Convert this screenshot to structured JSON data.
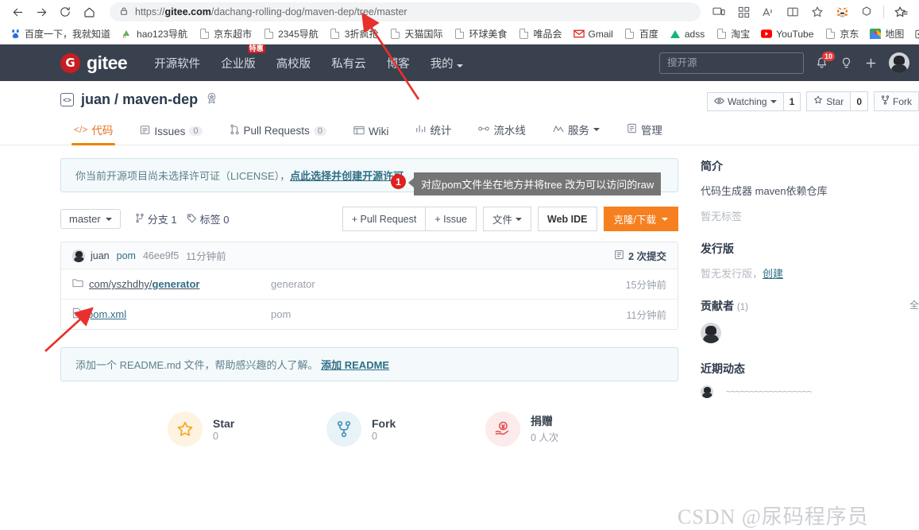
{
  "browser": {
    "url_prefix": "https://",
    "url_bold": "gitee.com",
    "url_suffix": "/dachang-rolling-dog/maven-dep/tree/master",
    "back_icon": "back-arrow-icon",
    "forward_icon": "forward-arrow-icon",
    "reload_icon": "reload-icon",
    "home_icon": "home-icon",
    "lock_icon": "lock-icon",
    "toolbar_icons": [
      {
        "name": "split-screen-icon",
        "glyph": "❐"
      },
      {
        "name": "collections-icon",
        "glyph": "▒"
      },
      {
        "name": "read-aloud-icon",
        "glyph": "A"
      },
      {
        "name": "reading-view-icon",
        "glyph": "◫"
      },
      {
        "name": "favorite-star-icon",
        "glyph": "☆"
      },
      {
        "name": "metamask-extension-icon",
        "glyph": "🦊"
      },
      {
        "name": "extension-puzzle-icon",
        "glyph": "⬡"
      },
      {
        "name": "favorites-list-icon",
        "glyph": "☆"
      }
    ],
    "bookmarks": [
      {
        "label": "百度一下，我就知道",
        "icon": "baidu-icon"
      },
      {
        "label": "hao123导航",
        "icon": "hao123-icon"
      },
      {
        "label": "京东超市",
        "icon": "page-icon"
      },
      {
        "label": "2345导航",
        "icon": "page-icon"
      },
      {
        "label": "3折疯抢",
        "icon": "page-icon"
      },
      {
        "label": "天猫国际",
        "icon": "page-icon"
      },
      {
        "label": "环球美食",
        "icon": "page-icon"
      },
      {
        "label": "唯品会",
        "icon": "page-icon"
      },
      {
        "label": "Gmail",
        "icon": "gmail-icon"
      },
      {
        "label": "百度",
        "icon": "page-icon"
      },
      {
        "label": "adss",
        "icon": "vercel-icon"
      },
      {
        "label": "淘宝",
        "icon": "page-icon"
      },
      {
        "label": "YouTube",
        "icon": "youtube-icon"
      },
      {
        "label": "京东",
        "icon": "page-icon"
      },
      {
        "label": "地图",
        "icon": "maps-icon"
      },
      {
        "label": "",
        "icon": "other-bookmarks-icon"
      }
    ]
  },
  "gitee_header": {
    "logo_mark": "G",
    "logo_word": "gitee",
    "nav": [
      {
        "label": "开源软件",
        "badge": ""
      },
      {
        "label": "企业版",
        "badge": "特惠"
      },
      {
        "label": "高校版",
        "badge": ""
      },
      {
        "label": "私有云",
        "badge": ""
      },
      {
        "label": "博客",
        "badge": ""
      },
      {
        "label": "我的",
        "badge": "",
        "caret": true
      }
    ],
    "search_placeholder": "搜开源",
    "notification_count": "10",
    "bell_icon": "bell-icon",
    "idea_icon": "lightbulb-icon",
    "plus_icon": "plus-icon",
    "avatar": "user-avatar"
  },
  "repo": {
    "owner": "juan",
    "separator": "/",
    "name": "maven-dep",
    "repo_icon": "code-repo-icon",
    "badge_icon": "award-badge-icon",
    "watch_label": "Watching",
    "watch_count": "1",
    "star_label": "Star",
    "star_count": "0",
    "fork_label": "Fork",
    "eye_icon": "eye-icon",
    "star_icon": "star-icon",
    "fork_icon": "fork-icon",
    "tabs": [
      {
        "label": "代码",
        "icon": "code-icon",
        "count": "",
        "active": true
      },
      {
        "label": "Issues",
        "icon": "issue-icon",
        "count": "0",
        "active": false
      },
      {
        "label": "Pull Requests",
        "icon": "pr-icon",
        "count": "0",
        "active": false
      },
      {
        "label": "Wiki",
        "icon": "wiki-icon",
        "count": "",
        "active": false
      },
      {
        "label": "统计",
        "icon": "chart-icon",
        "count": "",
        "active": false
      },
      {
        "label": "流水线",
        "icon": "pipeline-icon",
        "count": "",
        "active": false
      },
      {
        "label": "服务",
        "icon": "service-icon",
        "count": "",
        "active": false,
        "caret": true
      },
      {
        "label": "管理",
        "icon": "manage-icon",
        "count": "",
        "active": false
      }
    ]
  },
  "license_notice": {
    "text": "你当前开源项目尚未选择许可证（LICENSE），",
    "link": "点此选择并创建开源许可"
  },
  "file_toolbar": {
    "branch": "master",
    "branch_count_label": "分支 1",
    "tag_count_label": "标签 0",
    "branch_icon": "branch-icon",
    "tag_icon": "tag-icon",
    "pull_request_button": "+ Pull Request",
    "issue_button": "+ Issue",
    "files_button": "文件",
    "web_ide_button": "Web IDE",
    "clone_button": "克隆/下载"
  },
  "commit_bar": {
    "avatar": "user-avatar",
    "author": "juan",
    "message": "pom",
    "sha": "46ee9f5",
    "time": "11分钟前",
    "commits_icon": "commits-icon",
    "commits_label": "2 次提交"
  },
  "files": [
    {
      "icon": "folder-icon",
      "name_prefix": "com/yszhdhy/",
      "name_bold": "generator",
      "commit": "generator",
      "time": "15分钟前",
      "is_folder": true
    },
    {
      "icon": "file-icon",
      "name_prefix": "",
      "name_bold": "pom.xml",
      "commit": "pom",
      "time": "11分钟前",
      "is_folder": false
    }
  ],
  "readme_notice": {
    "text": "添加一个 README.md 文件，帮助感兴趣的人了解。",
    "link": "添加 README"
  },
  "stats": [
    {
      "label": "Star",
      "value": "0",
      "icon": "star-icon",
      "circle_bg": "#fdf3e0",
      "icon_color": "#f5a623"
    },
    {
      "label": "Fork",
      "value": "0",
      "icon": "fork-icon",
      "circle_bg": "#e8f3f7",
      "icon_color": "#4a90b8"
    },
    {
      "label": "捐赠",
      "value": "0 人次",
      "icon": "donate-icon",
      "circle_bg": "#fdeaea",
      "icon_color": "#e0585b"
    }
  ],
  "sidebar": {
    "intro_title": "简介",
    "intro_text": "代码生成器 maven依赖仓库",
    "no_tags": "暂无标签",
    "release_title": "发行版",
    "no_release": "暂无发行版，",
    "create_link": "创建",
    "contributor_title": "贡献者",
    "contributor_count": "(1)",
    "contributor_all": "全",
    "activity_title": "近期动态",
    "activity_text": "~~~~~~~~~~~~~~~~~~"
  },
  "annotations": {
    "badge_1": "1",
    "tooltip_1": "对应pom文件坐在地方并将tree 改为可以访问的raw",
    "arrow_color": "#e8302c"
  },
  "watermark": "CSDN @尿码程序员"
}
